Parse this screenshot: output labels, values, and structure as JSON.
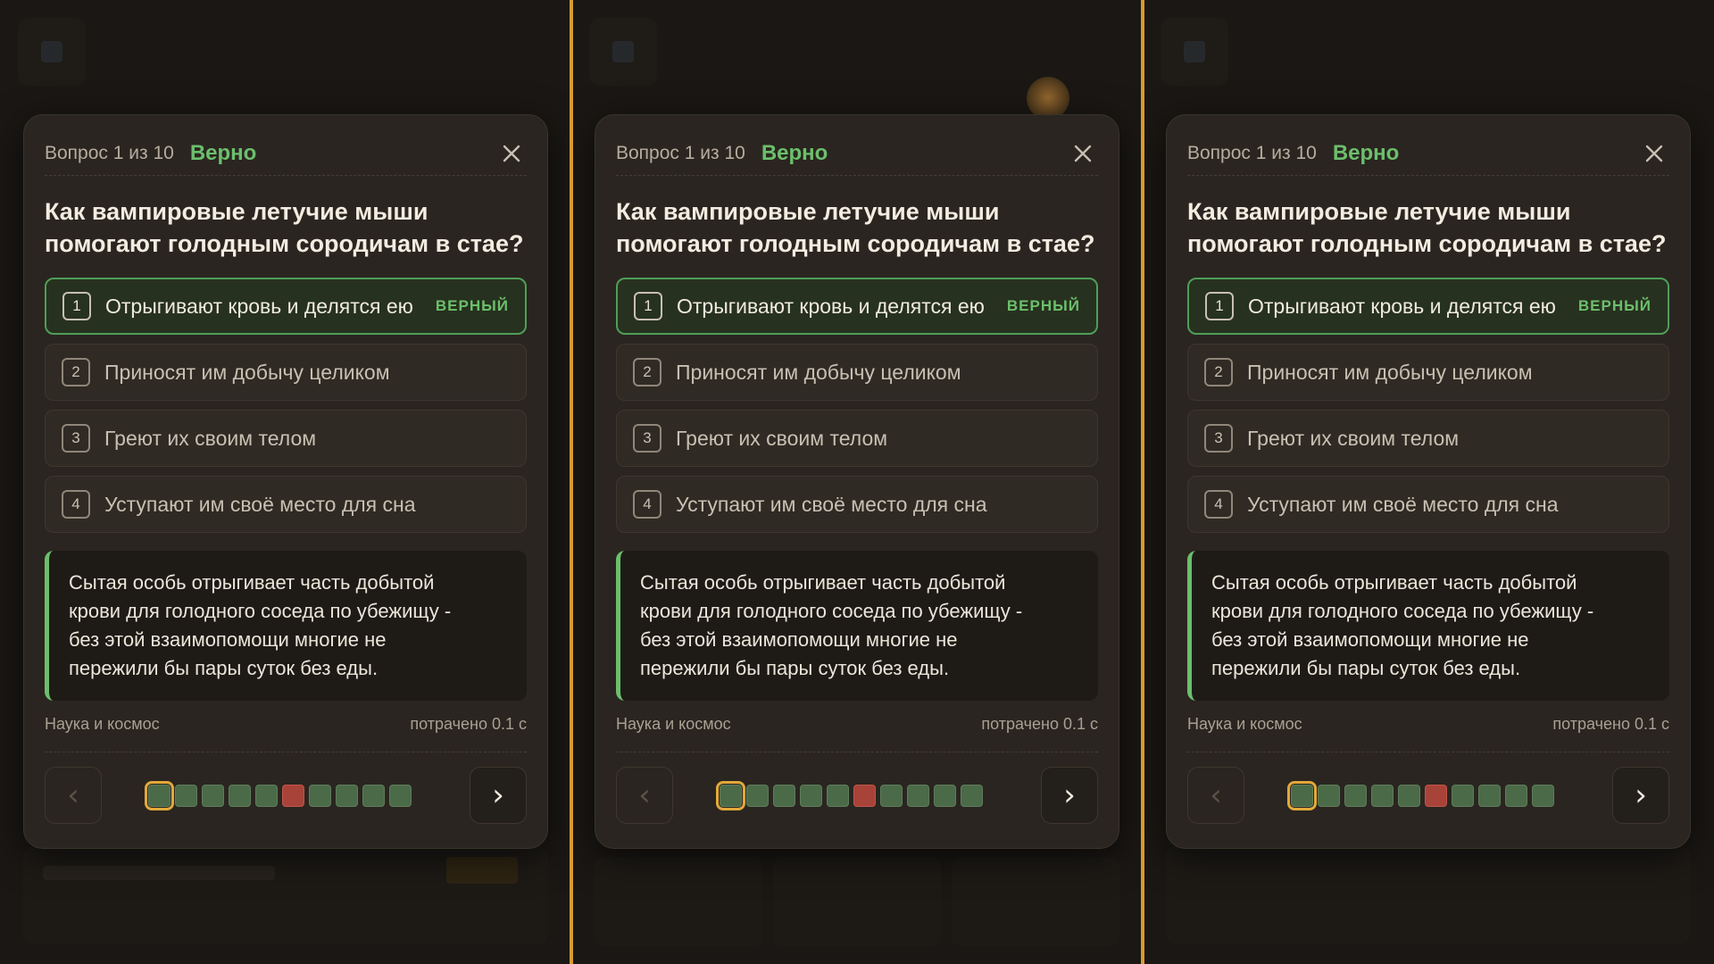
{
  "panels": [
    {
      "counter": "Вопрос 1 из 10",
      "status": "Верно",
      "question_line1": "Как вампировые летучие мыши",
      "question_line2": "помогают голодным сородичам в стае?",
      "options": [
        {
          "num": "1",
          "text": "Отрыгивают кровь и делятся ею",
          "badge": "ВЕРНЫЙ"
        },
        {
          "num": "2",
          "text": "Приносят им добычу целиком"
        },
        {
          "num": "3",
          "text": "Греют их своим телом"
        },
        {
          "num": "4",
          "text": "Уступают им своё место для сна"
        }
      ],
      "explanation_lines": [
        "Сытая особь отрыгивает часть добытой",
        "крови для голодного соседа по убежищу -",
        "без этой взаимопомощи многие не",
        "пережили бы пары суток без еды."
      ],
      "category": "Наука и космос",
      "time_spent": "потрачено 0.1 с",
      "prev_icon": "‹",
      "next_icon": "›",
      "progress": [
        "current-correct",
        "correct",
        "correct",
        "correct",
        "correct",
        "wrong",
        "correct",
        "correct",
        "correct",
        "correct"
      ]
    },
    {
      "counter": "Вопрос 1 из 10",
      "status": "Верно",
      "question_line1": "Как вампировые летучие мыши",
      "question_line2": "помогают голодным сородичам в стае?",
      "options": [
        {
          "num": "1",
          "text": "Отрыгивают кровь и делятся ею",
          "badge": "ВЕРНЫЙ"
        },
        {
          "num": "2",
          "text": "Приносят им добычу целиком"
        },
        {
          "num": "3",
          "text": "Греют их своим телом"
        },
        {
          "num": "4",
          "text": "Уступают им своё место для сна"
        }
      ],
      "explanation_lines": [
        "Сытая особь отрыгивает часть добытой",
        "крови для голодного соседа по убежищу -",
        "без этой взаимопомощи многие не",
        "пережили бы пары суток без еды."
      ],
      "category": "Наука и космос",
      "time_spent": "потрачено 0.1 с",
      "prev_icon": "‹",
      "next_icon": "›",
      "progress": [
        "current-correct",
        "correct",
        "correct",
        "correct",
        "correct",
        "wrong",
        "correct",
        "correct",
        "correct",
        "correct"
      ]
    },
    {
      "counter": "Вопрос 1 из 10",
      "status": "Верно",
      "question_line1": "Как вампировые летучие мыши",
      "question_line2": "помогают голодным сородичам в стае?",
      "options": [
        {
          "num": "1",
          "text": "Отрыгивают кровь и делятся ею",
          "badge": "ВЕРНЫЙ"
        },
        {
          "num": "2",
          "text": "Приносят им добычу целиком"
        },
        {
          "num": "3",
          "text": "Греют их своим телом"
        },
        {
          "num": "4",
          "text": "Уступают им своё место для сна"
        }
      ],
      "explanation_lines": [
        "Сытая особь отрыгивает часть добытой",
        "крови для голодного соседа по убежищу -",
        "без этой взаимопомощи многие не",
        "пережили бы пары суток без еды."
      ],
      "category": "Наука и космос",
      "time_spent": "потрачено 0.1 с",
      "prev_icon": "‹",
      "next_icon": "›",
      "progress": [
        "current-correct",
        "correct",
        "correct",
        "correct",
        "correct",
        "wrong",
        "correct",
        "correct",
        "correct",
        "correct"
      ]
    }
  ],
  "colors": {
    "accent_correct": "#6cbf6c",
    "accent_wrong": "#a8433a",
    "divider": "#d89a2e",
    "card_bg": "#2a2520"
  },
  "icons": {
    "close": "close-icon",
    "prev": "chevron-left-icon",
    "next": "chevron-right-icon"
  }
}
